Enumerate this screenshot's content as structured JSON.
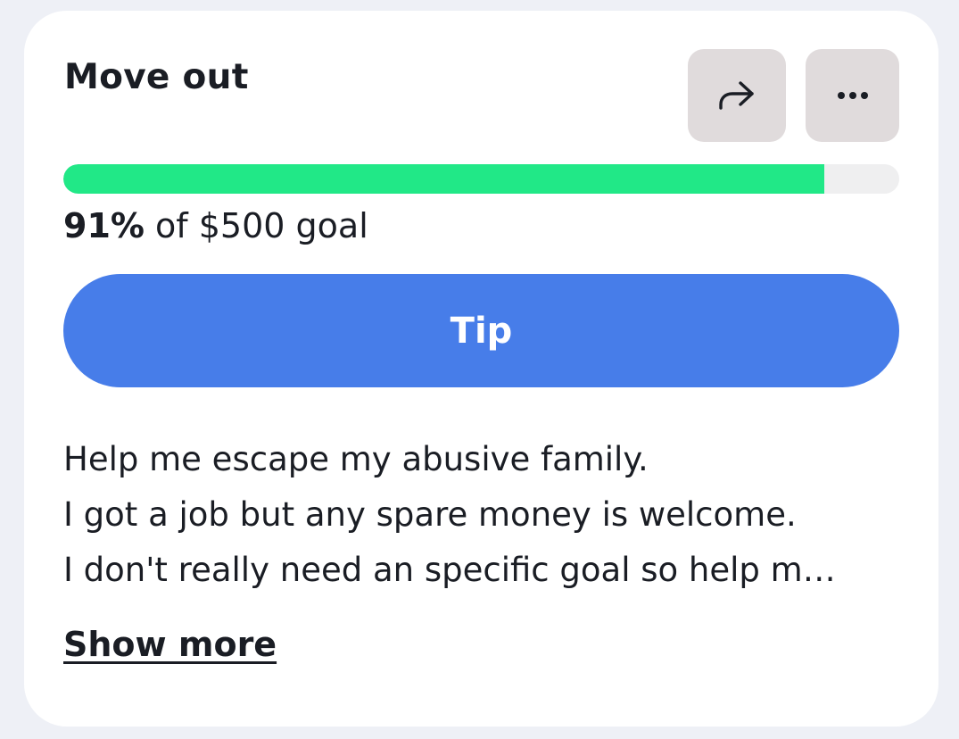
{
  "card": {
    "title": "Move out",
    "share_icon": "share-arrow-icon",
    "more_icon": "ellipsis-icon"
  },
  "progress": {
    "percent_value": 0.91,
    "percent_label": "91%",
    "goal_text": " of $500 goal"
  },
  "tip_button": {
    "label": "Tip"
  },
  "description": {
    "lines": [
      "Help me escape my abusive family.",
      "I got a job but any spare money is welcome.",
      "I don't really need an specific goal so help m…"
    ]
  },
  "show_more_label": "Show more",
  "colors": {
    "page_background": "#eef0f6",
    "card_background": "#ffffff",
    "progress_fill": "#21e887",
    "progress_track": "#efeff0",
    "tip_button": "#477de9",
    "icon_button": "#e0dbdc",
    "text": "#1a1d24"
  }
}
